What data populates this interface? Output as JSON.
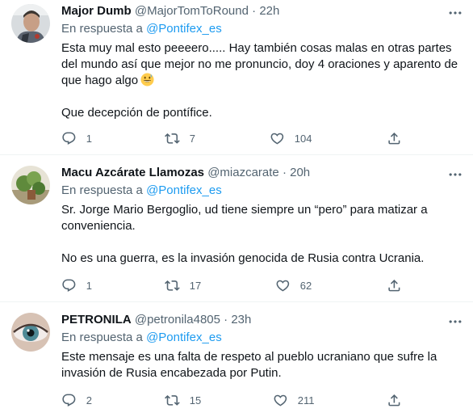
{
  "tweets": [
    {
      "name": "Major Dumb",
      "handle": "@MajorTomToRound",
      "separator": "·",
      "time": "22h",
      "reply_prefix": "En respuesta a",
      "reply_to": "@Pontifex_es",
      "paragraphs": [
        "Esta muy mal esto peeeero..... Hay también cosas malas en otras partes del mundo así que mejor no me pronuncio, doy 4 oraciones y aparento de que hago algo",
        "Que decepción de pontífice."
      ],
      "emoji": "grinning-face-with-sweat",
      "replies": "1",
      "retweets": "7",
      "likes": "104"
    },
    {
      "name": "Macu Azcárate Llamozas",
      "handle": "@miazcarate",
      "separator": "·",
      "time": "20h",
      "reply_prefix": "En respuesta a",
      "reply_to": "@Pontifex_es",
      "paragraphs": [
        "Sr. Jorge Mario Bergoglio, ud tiene siempre un “pero” para matizar a conveniencia.",
        "No es una guerra, es la invasión genocida de Rusia contra Ucrania."
      ],
      "replies": "1",
      "retweets": "17",
      "likes": "62"
    },
    {
      "name": "PETRONILA",
      "handle": "@petronila4805",
      "separator": "·",
      "time": "23h",
      "reply_prefix": "En respuesta a",
      "reply_to": "@Pontifex_es",
      "paragraphs": [
        "Este mensaje es una falta de respeto al pueblo ucraniano que sufre la invasión de Rusia encabezada por Putin."
      ],
      "replies": "2",
      "retweets": "15",
      "likes": "211"
    }
  ],
  "icons": {
    "reply": "reply-icon",
    "retweet": "retweet-icon",
    "like": "like-icon",
    "share": "share-icon",
    "more": "more-icon"
  },
  "colors": {
    "link": "#1d9bf0",
    "secondary": "#536471",
    "text": "#0f1419",
    "divider": "#eff3f4"
  }
}
